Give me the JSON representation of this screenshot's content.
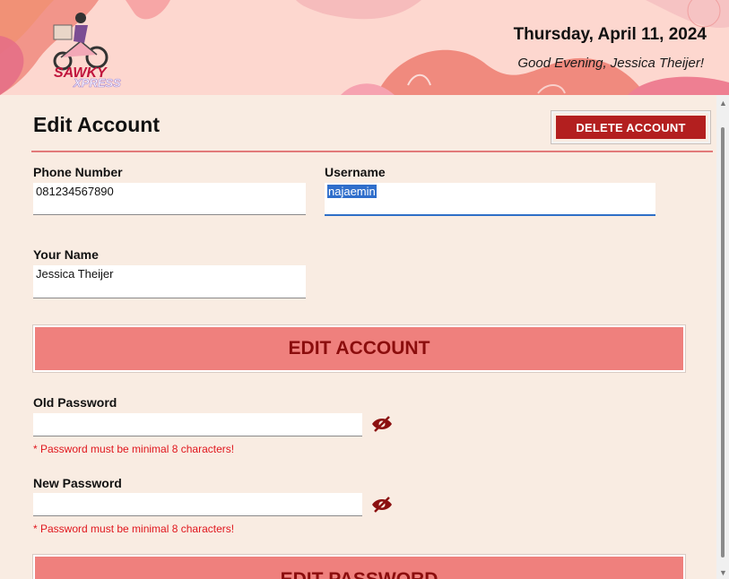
{
  "header": {
    "brand_top": "SAWKY",
    "brand_bottom": "XPRESS",
    "date": "Thursday, April 11, 2024",
    "greeting": "Good Evening, Jessica Theijer!"
  },
  "page": {
    "title": "Edit Account",
    "delete_label": "DELETE ACCOUNT"
  },
  "account_form": {
    "phone_label": "Phone Number",
    "phone_value": "081234567890",
    "username_label": "Username",
    "username_value": "najaemin",
    "name_label": "Your Name",
    "name_value": "Jessica Theijer",
    "submit_label": "EDIT ACCOUNT"
  },
  "password_form": {
    "old_label": "Old Password",
    "old_value": "",
    "old_hint": "* Password must be minimal 8 characters!",
    "new_label": "New Password",
    "new_value": "",
    "new_hint": "* Password must be minimal 8 characters!",
    "submit_label": "EDIT PASSWORD"
  },
  "icons": {
    "toggle_visibility": "eye-slash-icon",
    "scroll_up": "arrow-up-icon",
    "scroll_down": "arrow-down-icon"
  },
  "colors": {
    "accent_red": "#b31f1f",
    "button_salmon": "#ef807d",
    "button_text": "#8b0d0d",
    "hint_red": "#e0161d",
    "background": "#f9ece2",
    "banner": "#fdd7cf"
  }
}
